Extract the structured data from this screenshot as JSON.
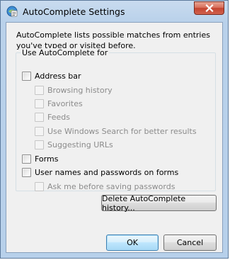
{
  "window": {
    "title": "AutoComplete Settings",
    "icon": "autocomplete-settings-icon",
    "close_icon": "close-icon"
  },
  "description": "AutoComplete lists possible matches from entries you've typed or visited before.",
  "group": {
    "legend": "Use AutoComplete for",
    "options": {
      "address_bar": "Address bar",
      "browsing_history": "Browsing history",
      "favorites": "Favorites",
      "feeds": "Feeds",
      "windows_search": "Use Windows Search for better results",
      "suggesting_urls": "Suggesting URLs",
      "forms": "Forms",
      "usernames_passwords": "User names and passwords on forms",
      "ask_before_saving": "Ask me before saving passwords"
    }
  },
  "buttons": {
    "delete_history": "Delete AutoComplete history...",
    "ok": "OK",
    "cancel": "Cancel"
  },
  "colors": {
    "close_button": "#c44430",
    "focus_border": "#3c7fb1",
    "disabled_text": "#8b8b8b"
  }
}
